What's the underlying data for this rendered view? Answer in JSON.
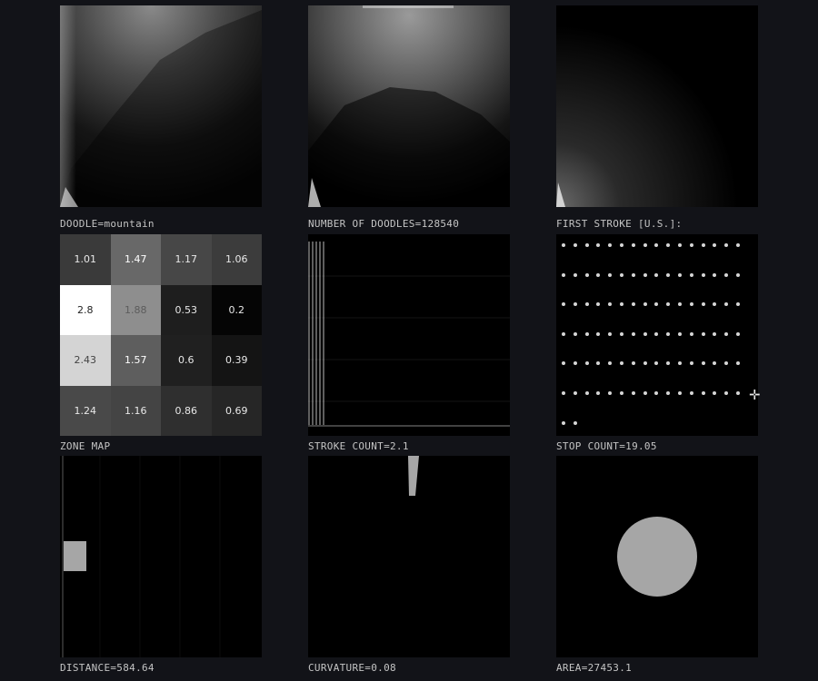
{
  "panels": {
    "doodle": {
      "caption": "DOODLE=mountain"
    },
    "count": {
      "caption": "NUMBER OF DOODLES=128540"
    },
    "first_stroke": {
      "caption": "FIRST STROKE [U.S.]:"
    },
    "zone_map": {
      "caption": "ZONE MAP",
      "rows": [
        [
          "1.01",
          "1.47",
          "1.17",
          "1.06"
        ],
        [
          "2.8",
          "1.88",
          "0.53",
          "0.2"
        ],
        [
          "2.43",
          "1.57",
          "0.6",
          "0.39"
        ],
        [
          "1.24",
          "1.16",
          "0.86",
          "0.69"
        ]
      ],
      "cell_colors": [
        [
          "#3a3a3a",
          "#686868",
          "#474747",
          "#3c3c3c"
        ],
        [
          "#ffffff",
          "#8e8e8e",
          "#1e1e1e",
          "#050505"
        ],
        [
          "#d4d4d4",
          "#5e5e5e",
          "#202020",
          "#141414"
        ],
        [
          "#494949",
          "#444444",
          "#2f2f2f",
          "#262626"
        ]
      ],
      "text_colors": [
        [
          "#e8e8e8",
          "#ffffff",
          "#e8e8e8",
          "#e8e8e8"
        ],
        [
          "#222222",
          "#5c5c5c",
          "#e8e8e8",
          "#e8e8e8"
        ],
        [
          "#444444",
          "#ffffff",
          "#e8e8e8",
          "#e8e8e8"
        ],
        [
          "#e8e8e8",
          "#e8e8e8",
          "#e8e8e8",
          "#e8e8e8"
        ]
      ]
    },
    "stroke_count": {
      "caption": "STROKE COUNT=2.1",
      "value": 2.1
    },
    "stop_count": {
      "caption": "STOP COUNT=19.05",
      "value": 19.05,
      "crosshair": "✛"
    },
    "distance": {
      "caption": "DISTANCE=584.64",
      "value": 584.64
    },
    "curvature": {
      "caption": "CURVATURE=0.08",
      "value": 0.08
    },
    "area": {
      "caption": "AREA=27453.1",
      "value": 27453.1
    }
  },
  "colors": {
    "background": "#121318",
    "panel": "#000000",
    "shape": "#a6a6a6"
  }
}
